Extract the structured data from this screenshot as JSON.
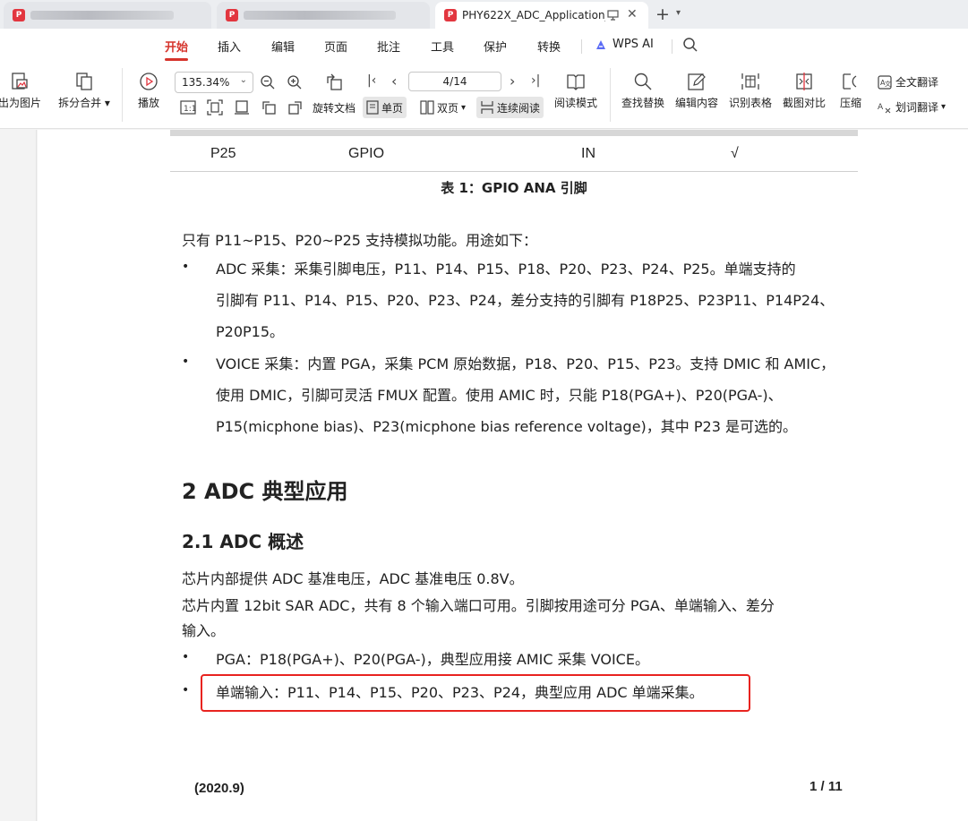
{
  "tabs": [
    {
      "title": "",
      "active": false
    },
    {
      "title": "",
      "active": false
    },
    {
      "title": "PHY622X_ADC_Application_",
      "active": true
    }
  ],
  "app_icon_text": "P",
  "menu": [
    "开始",
    "插入",
    "编辑",
    "页面",
    "批注",
    "工具",
    "保护",
    "转换"
  ],
  "wps_ai": "WPS AI",
  "toolbar": {
    "export_image": "出为图片",
    "split_merge": "拆分合并",
    "play": "播放",
    "zoom": "135.34%",
    "rotate": "旋转文档",
    "page": "4/14",
    "single_page": "单页",
    "double_page": "双页",
    "continuous": "连续阅读",
    "read_mode": "阅读模式",
    "find_replace": "查找替换",
    "edit_content": "编辑内容",
    "recognize_table": "识别表格",
    "screenshot_compare": "截图对比",
    "compress": "压缩",
    "full_translate": "全文翻译",
    "word_translate": "划词翻译"
  },
  "doc": {
    "table_row": [
      "P25",
      "GPIO",
      "IN",
      "√"
    ],
    "table_caption": "表 1：GPIO ANA 引脚",
    "intro": "只有 P11~P15、P20~P25 支持模拟功能。用途如下：",
    "adc_lines": [
      "ADC 采集：采集引脚电压，P11、P14、P15、P18、P20、P23、P24、P25。单端支持的",
      "引脚有 P11、P14、P15、P20、P23、P24，差分支持的引脚有 P18P25、P23P11、P14P24、",
      "P20P15。"
    ],
    "voice_lines": [
      "VOICE 采集：内置 PGA，采集 PCM 原始数据，P18、P20、P15、P23。支持 DMIC 和 AMIC，",
      "使用 DMIC，引脚可灵活 FMUX 配置。使用 AMIC 时，只能 P18(PGA+)、P20(PGA-)、",
      "P15(micphone bias)、P23(micphone bias reference voltage)，其中 P23 是可选的。"
    ],
    "h1": "2   ADC 典型应用",
    "h2": "2.1   ADC 概述",
    "p1": "芯片内部提供 ADC 基准电压，ADC 基准电压 0.8V。",
    "p2_lines": [
      "芯片内置 12bit SAR ADC，共有 8 个输入端口可用。引脚按用途可分 PGA、单端输入、差分",
      "输入。"
    ],
    "pga": "PGA：P18(PGA+)、P20(PGA-)，典型应用接 AMIC 采集 VOICE。",
    "single": "单端输入：P11、P14、P15、P20、P23、P24，典型应用 ADC 单端采集。",
    "bullet_char": "•",
    "footer_left": "(2020.9)",
    "footer_right": "1  / 11"
  }
}
